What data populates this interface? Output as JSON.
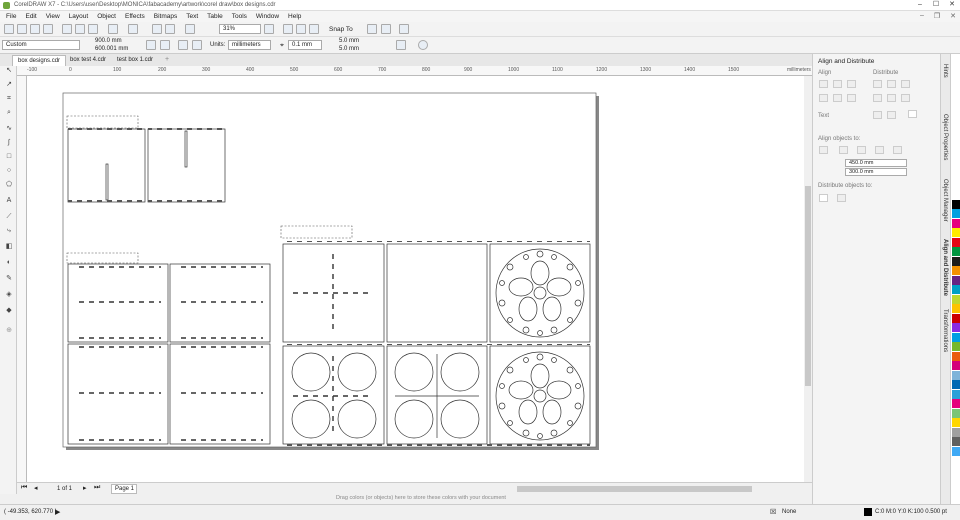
{
  "window": {
    "title": "CorelDRAW X7 - C:\\Users\\user\\Desktop\\MONICA\\fabacademy\\artwork\\corel draw\\box designs.cdr"
  },
  "menu": [
    "File",
    "Edit",
    "View",
    "Layout",
    "Object",
    "Effects",
    "Bitmaps",
    "Text",
    "Table",
    "Tools",
    "Window",
    "Help"
  ],
  "toolbar": {
    "zoom": "31%",
    "snap_to": "Snap To"
  },
  "propbar": {
    "paper": "Custom",
    "width": "900.0 mm",
    "height": "600.001 mm",
    "units_label": "Units:",
    "units": "millimeters",
    "nudge": "0.1 mm",
    "dup_x": "5.0 mm",
    "dup_y": "5.0 mm"
  },
  "tabs": [
    "box designs.cdr",
    "box test 4.cdr",
    "test box 1.cdr"
  ],
  "ruler": {
    "h": [
      "-100",
      "0",
      "100",
      "200",
      "300",
      "400",
      "500",
      "600",
      "700",
      "800",
      "900",
      "1000",
      "1100",
      "1200",
      "1300",
      "1400",
      "1500"
    ],
    "unit": "millimeters"
  },
  "pagenav": {
    "count": "1 of 1",
    "page": "Page 1"
  },
  "colorhint": "Drag colors (or objects) here to store these colors with your document",
  "status": {
    "coords": "( -49.353, 620.770 )",
    "fill": "None",
    "outline": "C:0 M:0 Y:0 K:100  0.500 pt"
  },
  "docker": {
    "title": "Align and Distribute",
    "align": "Align",
    "distribute": "Distribute",
    "text": "Text",
    "align_to": "Align objects to:",
    "x": "450.0 mm",
    "y": "300.0 mm",
    "distribute_to": "Distribute objects to:"
  },
  "docker_tabs": [
    "Hints",
    "Object Properties",
    "Object Manager",
    "Align and Distribute",
    "Transformations"
  ],
  "palette": [
    "#ffffff",
    "#000000",
    "#00a0e0",
    "#e6007e",
    "#ffed00",
    "#e30613",
    "#009640",
    "#1d1d1b",
    "#f39200",
    "#662483",
    "#00a0c6",
    "#c0d72f",
    "#fdc300",
    "#cc0000",
    "#8a2be2",
    "#009fe3",
    "#76b82a",
    "#ea5b0c",
    "#d4007a",
    "#7fb4d9",
    "#0069b4",
    "#2aa0d8",
    "#e5007d",
    "#7cc576",
    "#ffd700",
    "#a0a0a0",
    "#606060",
    "#3fa9f5"
  ]
}
